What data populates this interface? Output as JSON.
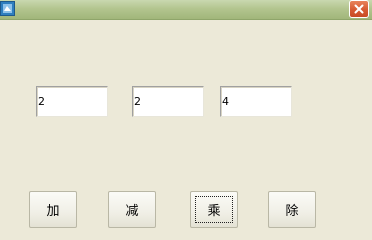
{
  "window": {
    "title_icon": "app-icon",
    "close_icon": "close-icon"
  },
  "fields": {
    "first": {
      "value": "2"
    },
    "second": {
      "value": "2"
    },
    "result": {
      "value": "4"
    }
  },
  "buttons": {
    "add": "加",
    "subtract": "减",
    "multiply": "乘",
    "divide": "除"
  },
  "colors": {
    "titlebar": "#b3c58f",
    "close_button": "#d65a32",
    "window_background": "#ece9d8"
  }
}
